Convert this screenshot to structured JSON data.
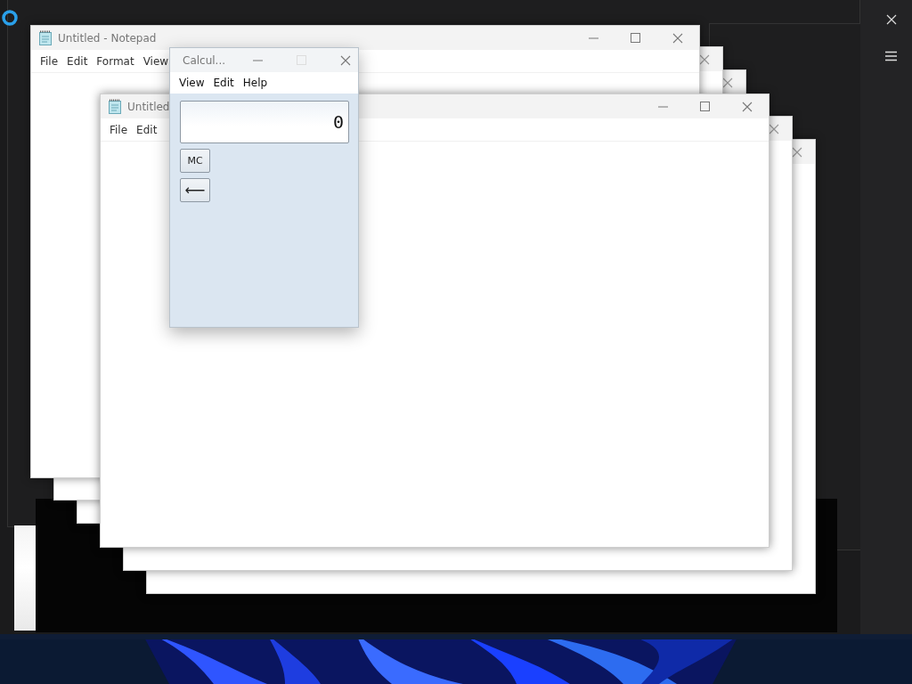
{
  "notepad_windows": [
    {
      "kind": "ghost"
    },
    {
      "kind": "ghost"
    },
    {
      "kind": "full",
      "title": "Untitled - Notepad",
      "menu": [
        "File",
        "Edit",
        "Format",
        "View"
      ]
    },
    {
      "kind": "ghost"
    },
    {
      "kind": "ghost"
    },
    {
      "kind": "full",
      "title": "Untitled",
      "menu": [
        "File",
        "Edit"
      ]
    }
  ],
  "calculator": {
    "title": "Calcul...",
    "menu": [
      "View",
      "Edit",
      "Help"
    ],
    "maximize_disabled": true,
    "display": "0",
    "buttons": [
      "MC",
      "⟵"
    ]
  }
}
